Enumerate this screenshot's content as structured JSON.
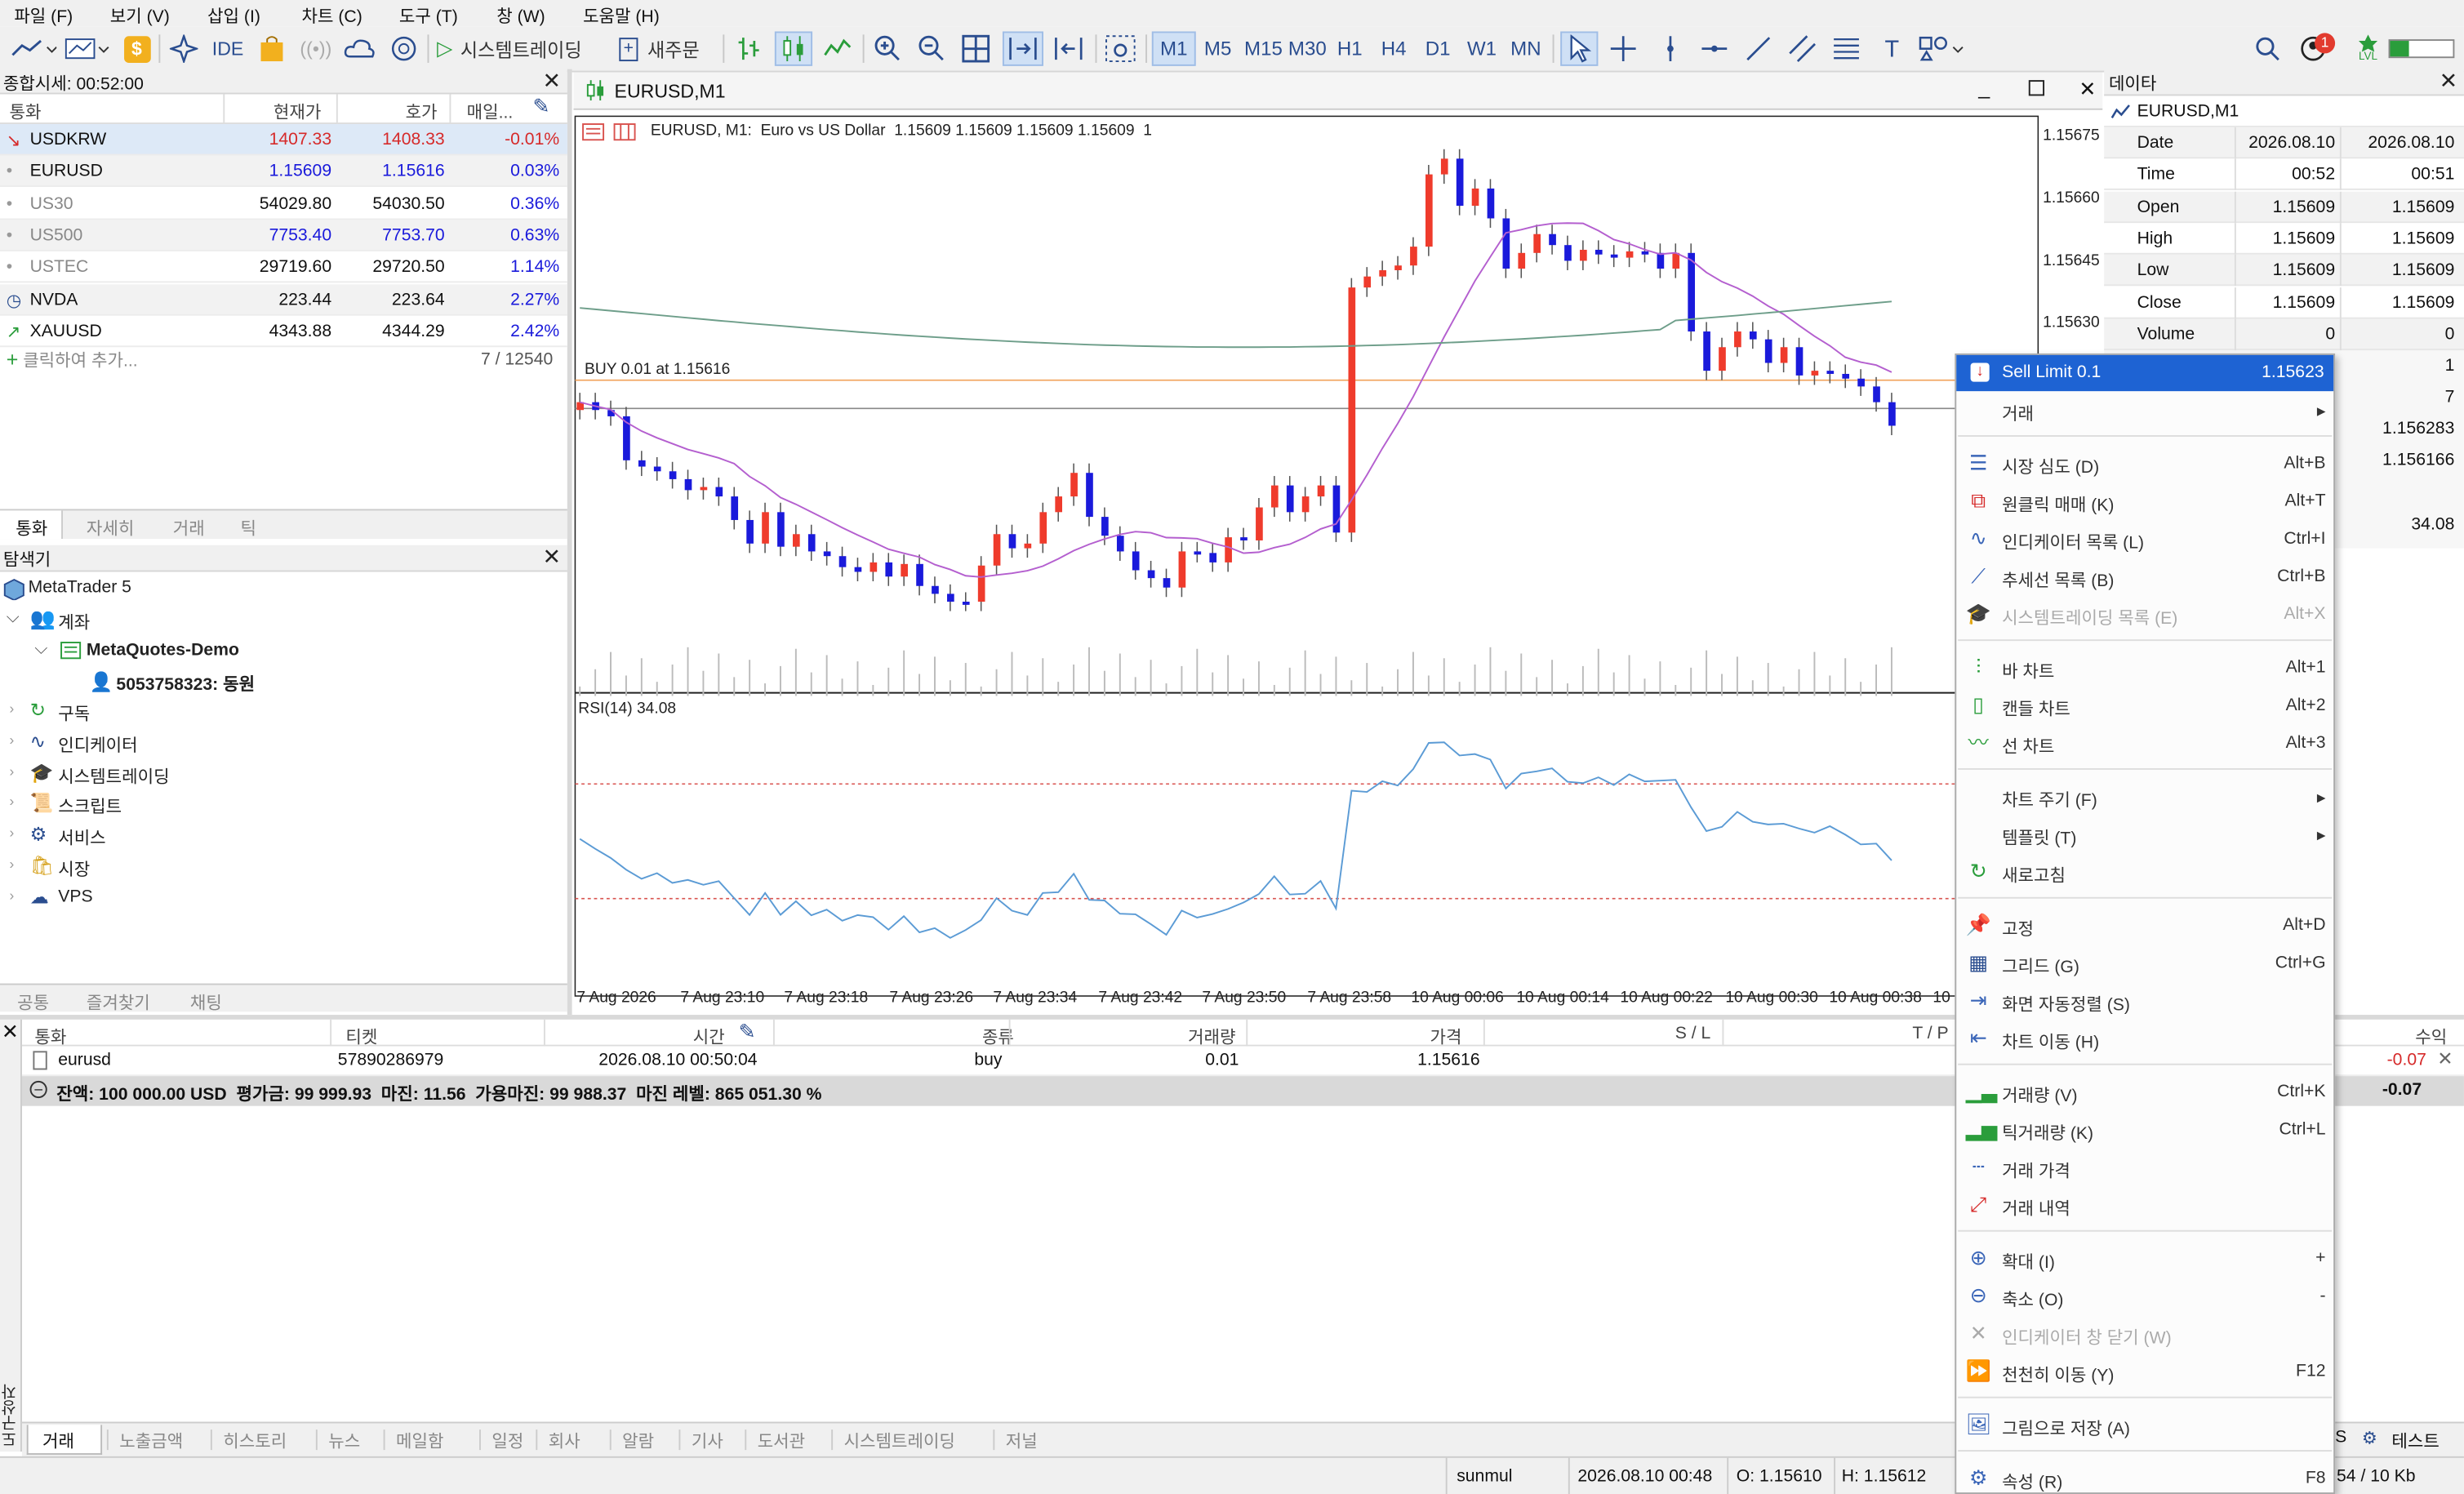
{
  "menu": [
    "파일 (F)",
    "보기 (V)",
    "삽입 (I)",
    "차트 (C)",
    "도구 (T)",
    "창 (W)",
    "도움말 (H)"
  ],
  "toolbar": {
    "ide": "IDE",
    "algo": "시스템트레이딩",
    "new_order": "새주문",
    "timeframes": [
      "M1",
      "M5",
      "M15",
      "M30",
      "H1",
      "H4",
      "D1",
      "W1",
      "MN"
    ],
    "active_tf": "M1",
    "notif_count": "1",
    "lvl": "LVL"
  },
  "market_watch": {
    "title": "종합시세: 00:52:00",
    "cols": [
      "통화",
      "현재가",
      "호가",
      "매일..."
    ],
    "rows": [
      {
        "sym": "USDKRW",
        "bid": "1407.33",
        "ask": "1408.33",
        "chg": "-0.01%"
      },
      {
        "sym": "EURUSD",
        "bid": "1.15609",
        "ask": "1.15616",
        "chg": "0.03%"
      },
      {
        "sym": "US30",
        "bid": "54029.80",
        "ask": "54030.50",
        "chg": "0.36%"
      },
      {
        "sym": "US500",
        "bid": "7753.40",
        "ask": "7753.70",
        "chg": "0.63%"
      },
      {
        "sym": "USTEC",
        "bid": "29719.60",
        "ask": "29720.50",
        "chg": "1.14%"
      },
      {
        "sym": "NVDA",
        "bid": "223.44",
        "ask": "223.64",
        "chg": "2.27%"
      },
      {
        "sym": "XAUUSD",
        "bid": "4343.88",
        "ask": "4344.29",
        "chg": "2.42%"
      }
    ],
    "add": "클릭하여 추가...",
    "count": "7 / 12540",
    "tabs": [
      "통화",
      "자세히",
      "거래",
      "틱"
    ]
  },
  "navigator": {
    "title": "탐색기",
    "root": "MetaTrader 5",
    "accounts": "계좌",
    "server": "MetaQuotes-Demo",
    "account": "5053758323: 동원",
    "items": [
      "구독",
      "인디케이터",
      "시스템트레이딩",
      "스크립트",
      "서비스",
      "시장",
      "VPS"
    ],
    "tabs": [
      "공통",
      "즐겨찾기",
      "채팅"
    ]
  },
  "chart": {
    "window_title": "EURUSD,M1",
    "info": "EURUSD, M1:  Euro vs US Dollar  1.15609 1.15609 1.15609 1.15609  1",
    "buy_label": "BUY 0.01 at 1.15616",
    "rsi_label": "RSI(14) 34.08",
    "price_ticks": [
      "1.15675",
      "1.15660",
      "1.15645",
      "1.15630"
    ],
    "time_ticks": [
      "7 Aug 2026",
      "7 Aug 23:10",
      "7 Aug 23:18",
      "7 Aug 23:26",
      "7 Aug 23:34",
      "7 Aug 23:42",
      "7 Aug 23:50",
      "7 Aug 23:58",
      "10 Aug 00:06",
      "10 Aug 00:14",
      "10 Aug 00:22",
      "10 Aug 00:30",
      "10 Aug 00:38",
      "10"
    ]
  },
  "data_window": {
    "title": "데이타",
    "symbol": "EURUSD,M1",
    "rows": [
      {
        "k": "Date",
        "a": "2026.08.10",
        "b": "2026.08.10"
      },
      {
        "k": "Time",
        "a": "00:52",
        "b": "00:51"
      },
      {
        "k": "Open",
        "a": "1.15609",
        "b": "1.15609"
      },
      {
        "k": "High",
        "a": "1.15609",
        "b": "1.15609"
      },
      {
        "k": "Low",
        "a": "1.15609",
        "b": "1.15609"
      },
      {
        "k": "Close",
        "a": "1.15609",
        "b": "1.15609"
      },
      {
        "k": "Volume",
        "a": "0",
        "b": "0"
      }
    ],
    "partial": [
      "1",
      "7",
      "1.156283",
      "1.156166",
      "34.08"
    ]
  },
  "context_menu": {
    "header": {
      "label": "Sell Limit 0.1",
      "price": "1.15623"
    },
    "items": [
      {
        "label": "거래",
        "kb": "",
        "arrow": true
      },
      {
        "sep": true
      },
      {
        "label": "시장 심도 (D)",
        "kb": "Alt+B",
        "icon": "depth-icon"
      },
      {
        "label": "원클릭 매매 (K)",
        "kb": "Alt+T",
        "icon": "oneclick-icon"
      },
      {
        "label": "인디케이터 목록 (L)",
        "kb": "Ctrl+I",
        "icon": "indicator-list-icon"
      },
      {
        "label": "추세선 목록 (B)",
        "kb": "Ctrl+B",
        "icon": "trendline-list-icon"
      },
      {
        "label": "시스템트레이딩 목록 (E)",
        "kb": "Alt+X",
        "icon": "expert-icon",
        "dis": true
      },
      {
        "sep": true
      },
      {
        "label": "바 차트",
        "kb": "Alt+1",
        "icon": "bar-chart-icon"
      },
      {
        "label": "캔들 차트",
        "kb": "Alt+2",
        "icon": "candle-chart-icon"
      },
      {
        "label": "선 차트",
        "kb": "Alt+3",
        "icon": "line-chart-icon"
      },
      {
        "sep": true
      },
      {
        "label": "차트 주기 (F)",
        "kb": "",
        "arrow": true
      },
      {
        "label": "템플릿 (T)",
        "kb": "",
        "arrow": true
      },
      {
        "label": "새로고침",
        "kb": "",
        "icon": "refresh-icon"
      },
      {
        "sep": true
      },
      {
        "label": "고정",
        "kb": "Alt+D",
        "icon": "pin-icon"
      },
      {
        "label": "그리드 (G)",
        "kb": "Ctrl+G",
        "icon": "grid-icon"
      },
      {
        "label": "화면 자동정렬 (S)",
        "kb": "",
        "icon": "autoscroll-icon"
      },
      {
        "label": "차트 이동 (H)",
        "kb": "",
        "icon": "chart-shift-icon"
      },
      {
        "sep": true
      },
      {
        "label": "거래량 (V)",
        "kb": "Ctrl+K",
        "icon": "volume-icon"
      },
      {
        "label": "틱거래량 (K)",
        "kb": "Ctrl+L",
        "icon": "tick-volume-icon"
      },
      {
        "label": "거래 가격",
        "kb": "",
        "icon": "trade-levels-icon"
      },
      {
        "label": "거래 내역",
        "kb": "",
        "icon": "trade-history-icon"
      },
      {
        "sep": true
      },
      {
        "label": "확대 (I)",
        "kb": "+",
        "icon": "zoom-in-icon"
      },
      {
        "label": "축소 (O)",
        "kb": "-",
        "icon": "zoom-out-icon"
      },
      {
        "label": "인디케이터 창 닫기 (W)",
        "kb": "",
        "icon": "close-icon",
        "dis": true
      },
      {
        "label": "천천히 이동 (Y)",
        "kb": "F12",
        "icon": "step-icon"
      },
      {
        "sep": true
      },
      {
        "label": "그림으로 저장 (A)",
        "kb": "",
        "icon": "save-picture-icon"
      },
      {
        "sep": true
      },
      {
        "label": "속성 (R)",
        "kb": "F8",
        "icon": "properties-icon"
      }
    ]
  },
  "toolbox": {
    "cols": [
      "통화",
      "티켓",
      "시간",
      "종류",
      "거래량",
      "가격",
      "S / L",
      "T / P",
      "수익"
    ],
    "row": {
      "sym": "eurusd",
      "ticket": "57890286979",
      "time": "2026.08.10 00:50:04",
      "type": "buy",
      "vol": "0.01",
      "price": "1.15616",
      "profit": "-0.07"
    },
    "balance": "잔액: 100 000.00 USD  평가금: 99 999.93  마진: 11.56  가용마진: 99 988.37  마진 레벨: 865 051.30 %",
    "total": "-0.07",
    "tabs": [
      "거래",
      "노출금액",
      "히스토리",
      "뉴스",
      "메일함",
      "일정",
      "회사",
      "알람",
      "기사",
      "도서관",
      "시스템트레이딩",
      "저널"
    ],
    "side_label": "도구상자",
    "right_tabs": [
      "S",
      "테스트"
    ]
  },
  "status": {
    "profile": "sunmul",
    "time": "2026.08.10 00:48",
    "o": "O: 1.15610",
    "h": "H: 1.15612",
    "traffic": "54 / 10 Kb"
  },
  "colors": {
    "up": "#ef3b2c",
    "down": "#1a1adb",
    "ma": "#b45fcf",
    "ma_slow": "#6e9e8a",
    "rsi": "#5b9bd5",
    "select": "#1e63d3",
    "neg": "#d62a2a",
    "pos": "#1a1adb"
  }
}
